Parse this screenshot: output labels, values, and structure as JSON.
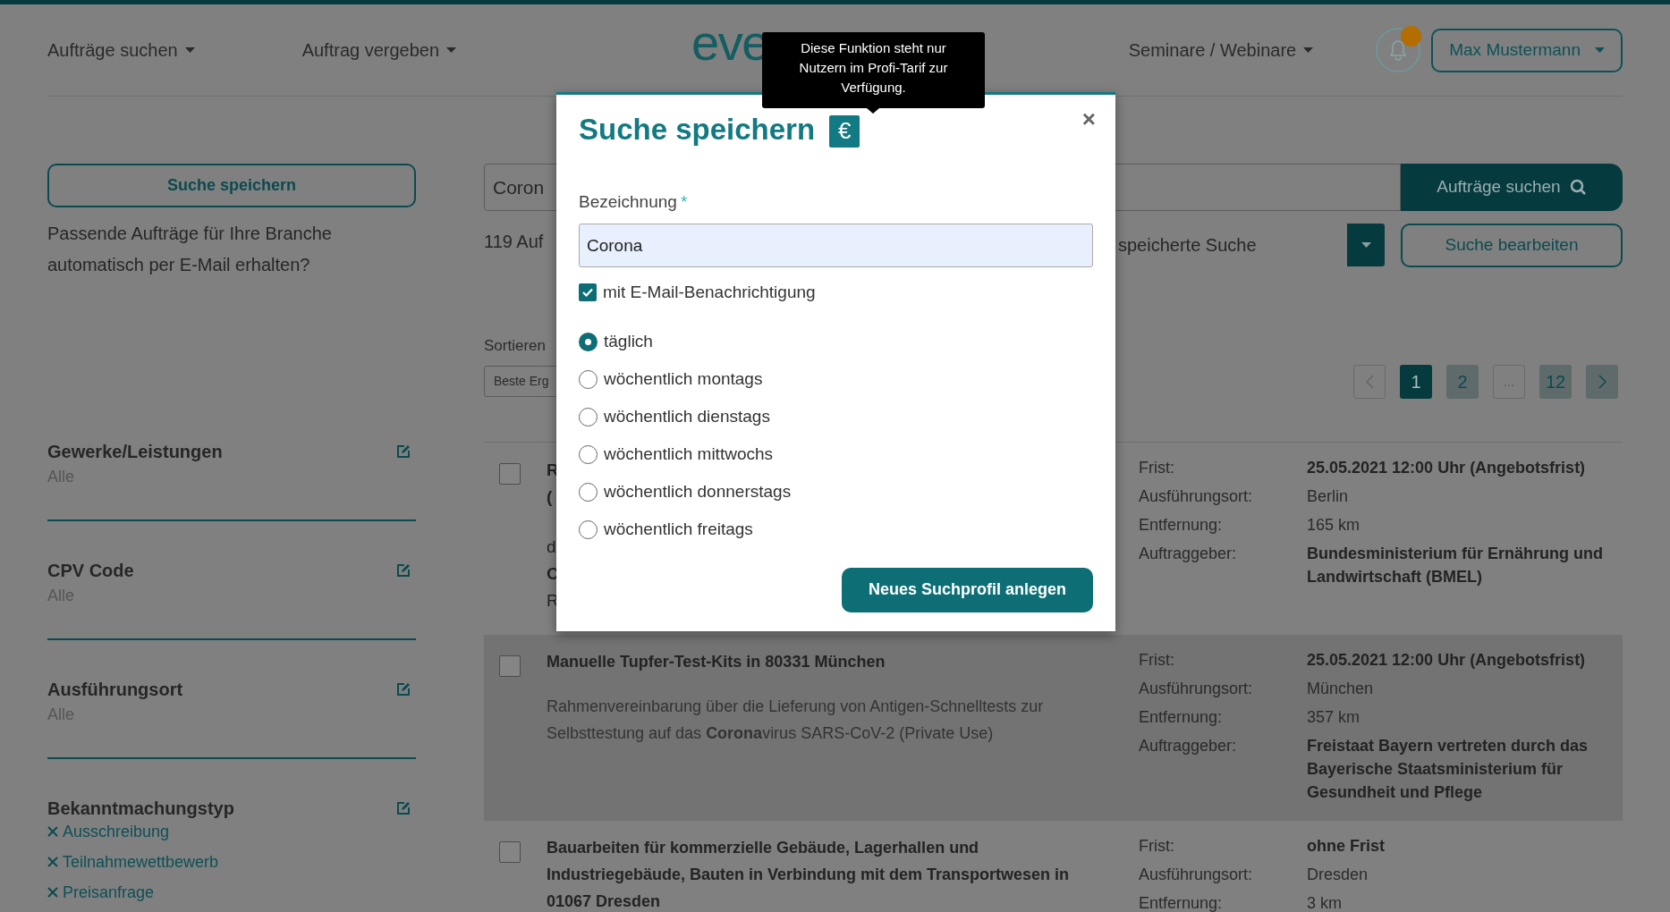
{
  "nav": {
    "menus": [
      {
        "label": "Aufträge suchen"
      },
      {
        "label": "Auftrag vergeben"
      }
    ],
    "logo": "eve",
    "right_menu": {
      "label": "Seminare / Webinare"
    },
    "notifications": {
      "unread": true
    },
    "user_menu": {
      "label": "Max Mustermann"
    }
  },
  "sidebar": {
    "save_button": "Suche speichern",
    "hint": "Passende Aufträge für Ihre Branche automatisch per E-Mail erhalten?",
    "filters": [
      {
        "title": "Gewerke/Leistungen",
        "values": [
          {
            "kind": "summary",
            "text": "Alle"
          }
        ]
      },
      {
        "title": "CPV Code",
        "values": [
          {
            "kind": "summary",
            "text": "Alle"
          }
        ]
      },
      {
        "title": "Ausführungsort",
        "values": [
          {
            "kind": "summary",
            "text": "Alle"
          }
        ]
      },
      {
        "title": "Bekanntmachungstyp",
        "values": [
          {
            "kind": "tag",
            "text": "Ausschreibung"
          },
          {
            "kind": "tag",
            "text": "Teilnahmewettbewerb"
          },
          {
            "kind": "tag",
            "text": "Preisanfrage"
          }
        ]
      }
    ]
  },
  "search": {
    "value": "Coron",
    "button": "Aufträge suchen",
    "result_count": "119 Auf",
    "saved_search": "speicherte Suche",
    "edit_button": "Suche bearbeiten"
  },
  "sort": {
    "label": "Sortieren",
    "value": "Beste Erg"
  },
  "pagination": {
    "prev_disabled": true,
    "next_disabled": false,
    "pages": [
      {
        "kind": "page",
        "label": "1",
        "selected": true
      },
      {
        "kind": "page",
        "label": "2",
        "selected": false
      },
      {
        "kind": "gap",
        "label": "...",
        "selected": false
      },
      {
        "kind": "page",
        "label": "12",
        "selected": false
      }
    ]
  },
  "results": [
    {
      "checked": false,
      "highlighted": false,
      "fragments": [
        {
          "text": "R",
          "bold": true
        },
        {
          "text": "(",
          "bold": true
        },
        {
          "text": "d",
          "bold": false
        },
        {
          "text": "C",
          "bold": true
        },
        {
          "text": "R",
          "bold": false
        }
      ],
      "meta": [
        {
          "label": "Frist:",
          "value": "25.05.2021 12:00 Uhr (Angebotsfrist)",
          "bold": true
        },
        {
          "label": "Ausführungsort:",
          "value": "Berlin",
          "bold": false
        },
        {
          "label": "Entfernung:",
          "value": "165 km",
          "bold": false
        },
        {
          "label": "Auftraggeber:",
          "value": "Bundesministerium für Ernährung und Landwirtschaft (BMEL)",
          "bold": true
        }
      ]
    },
    {
      "checked": false,
      "highlighted": true,
      "title": "Manuelle Tupfer-Test-Kits in 80331 München",
      "description": "Rahmenvereinbarung über die Lieferung von Antigen-Schnelltests zur Selbsttestung auf das **Corona**virus SARS-CoV-2 (Private Use)",
      "meta": [
        {
          "label": "Frist:",
          "value": "25.05.2021 12:00 Uhr (Angebotsfrist)",
          "bold": true
        },
        {
          "label": "Ausführungsort:",
          "value": "München",
          "bold": false
        },
        {
          "label": "Entfernung:",
          "value": "357 km",
          "bold": false
        },
        {
          "label": "Auftraggeber:",
          "value": "Freistaat Bayern vertreten durch das Bayerische Staatsministerium für Gesundheit und Pflege",
          "bold": true
        }
      ]
    },
    {
      "checked": false,
      "highlighted": false,
      "title": "Bauarbeiten für kommerzielle Gebäude, Lagerhallen und Industriegebäude, Bauten in Verbindung mit dem Transportwesen in 01067 Dresden",
      "meta": [
        {
          "label": "Frist:",
          "value": "ohne Frist",
          "bold": true
        },
        {
          "label": "Ausführungsort:",
          "value": "Dresden",
          "bold": false
        },
        {
          "label": "Entfernung:",
          "value": "3 km",
          "bold": false
        }
      ]
    }
  ],
  "modal": {
    "title": "Suche speichern",
    "badge": "€",
    "tooltip": "Diese Funktion steht nur Nutzern im Profi-Tarif zur Verfügung.",
    "close": "×",
    "field_label": "Bezeichnung",
    "required_mark": "*",
    "field_value": "Corona",
    "email_notify": {
      "label": "mit E-Mail-Benachrichtigung",
      "checked": true
    },
    "frequency": [
      {
        "label": "täglich",
        "selected": true
      },
      {
        "label": "wöchentlich montags",
        "selected": false
      },
      {
        "label": "wöchentlich dienstags",
        "selected": false
      },
      {
        "label": "wöchentlich mittwochs",
        "selected": false
      },
      {
        "label": "wöchentlich donnerstags",
        "selected": false
      },
      {
        "label": "wöchentlich freitags",
        "selected": false
      }
    ],
    "submit": "Neues Suchprofil anlegen"
  }
}
